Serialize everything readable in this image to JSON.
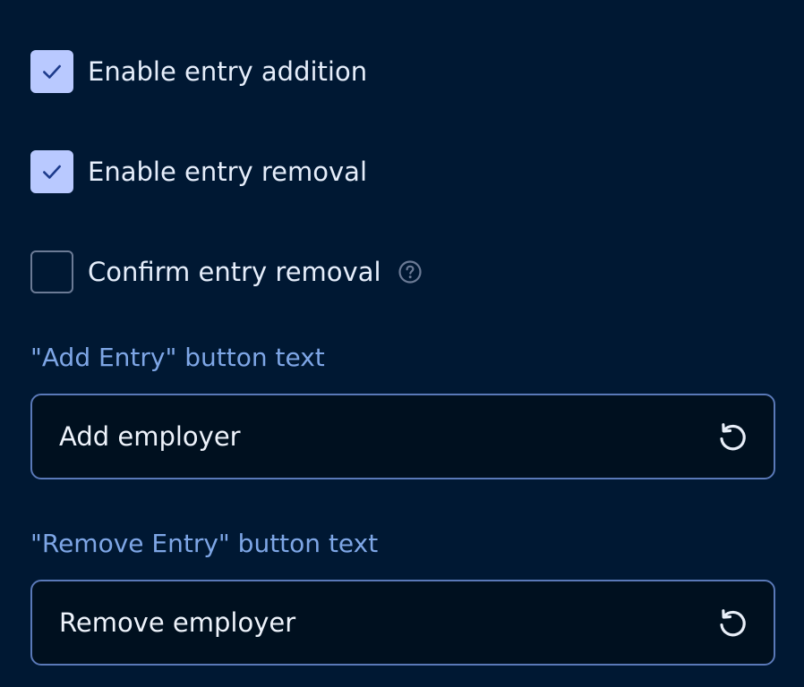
{
  "options": {
    "items": [
      {
        "label": "Enable entry addition",
        "checked": true,
        "icon": "check-icon"
      },
      {
        "label": "Enable entry removal",
        "checked": true,
        "icon": "check-icon"
      },
      {
        "label": "Confirm entry removal",
        "checked": false,
        "help_icon": "help-circle-icon"
      }
    ]
  },
  "fields": {
    "add_entry": {
      "label": "\"Add Entry\" button text",
      "value": "Add employer",
      "reset_icon": "reset-icon"
    },
    "remove_entry": {
      "label": "\"Remove Entry\" button text",
      "value": "Remove employer",
      "reset_icon": "reset-icon"
    }
  },
  "colors": {
    "background": "#001833",
    "checkbox_checked": "#b9c9ff",
    "check_mark": "#1d3b8c",
    "field_label": "#7ea6e6",
    "field_border": "#5a79b8",
    "field_background": "#00101f",
    "text": "#e6eefb"
  }
}
